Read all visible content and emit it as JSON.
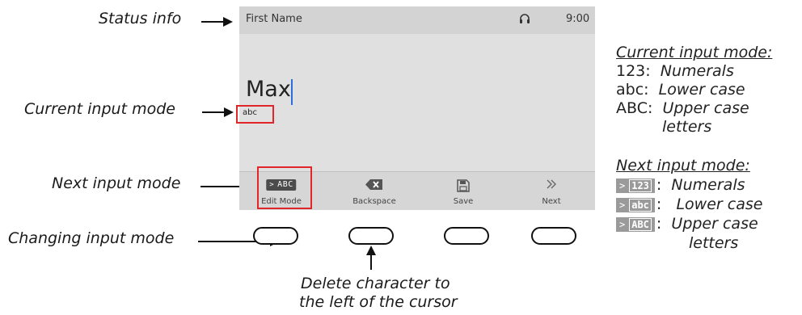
{
  "callouts": {
    "status_info": "Status info",
    "current_input_mode": "Current input mode",
    "next_input_mode": "Next input mode",
    "changing_input_mode": "Changing input mode",
    "delete_line1": "Delete character to",
    "delete_line2": "the left of the cursor"
  },
  "screen": {
    "field_title": "First Name",
    "time": "9:00",
    "entered_value": "Max",
    "current_mode_badge": "abc",
    "softkeys": [
      {
        "label": "Edit Mode",
        "icon": "edit-mode-icon",
        "chip_text": "ABC"
      },
      {
        "label": "Backspace",
        "icon": "backspace-icon"
      },
      {
        "label": "Save",
        "icon": "save-icon"
      },
      {
        "label": "Next",
        "icon": "next-icon"
      }
    ],
    "status_icon": "headset-icon"
  },
  "legend": {
    "current_heading": "Current input mode:",
    "current_rows": [
      {
        "code": "123:",
        "desc": "Numerals"
      },
      {
        "code": "abc:",
        "desc": "Lower case"
      },
      {
        "code": "ABC:",
        "desc": "Upper case",
        "desc2": "letters"
      }
    ],
    "next_heading": "Next input mode:",
    "next_rows": [
      {
        "chip": "123",
        "desc": "Numerals"
      },
      {
        "chip": "abc",
        "desc": "Lower case"
      },
      {
        "chip": "ABC",
        "desc": "Upper case",
        "desc2": "letters"
      }
    ]
  },
  "colors": {
    "highlight": "#e0262b",
    "cursor": "#2a6fdb",
    "chip": "#4b4b4b"
  }
}
